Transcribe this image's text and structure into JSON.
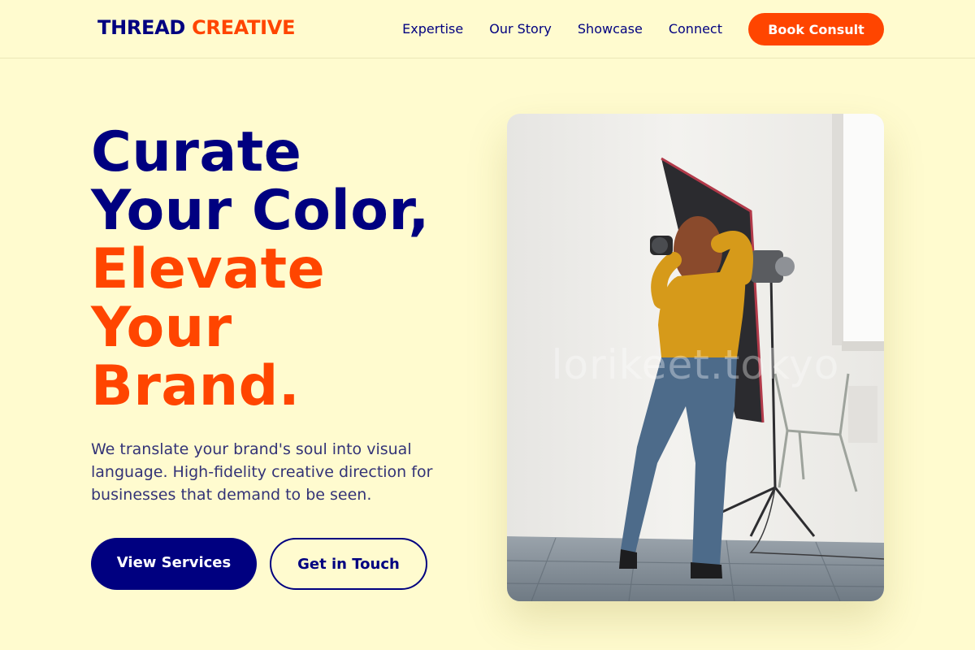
{
  "brand": {
    "part1": "THREAD",
    "part2": "CREATIVE"
  },
  "nav": {
    "links": [
      "Expertise",
      "Our Story",
      "Showcase",
      "Connect"
    ],
    "cta": "Book Consult"
  },
  "hero": {
    "title_line1": "Curate",
    "title_line2": "Your Color,",
    "title_line3": "Elevate",
    "title_line4": "Your",
    "title_line5": "Brand.",
    "description": "We translate your brand's soul into visual language. High-fidelity creative direction for businesses that demand to be seen.",
    "primary_button": "View Services",
    "secondary_button": "Get in Touch"
  },
  "image": {
    "watermark": "lorikeet.tokyo"
  },
  "colors": {
    "background": "#fffbcf",
    "navy": "#000080",
    "accent": "#ff4500"
  }
}
